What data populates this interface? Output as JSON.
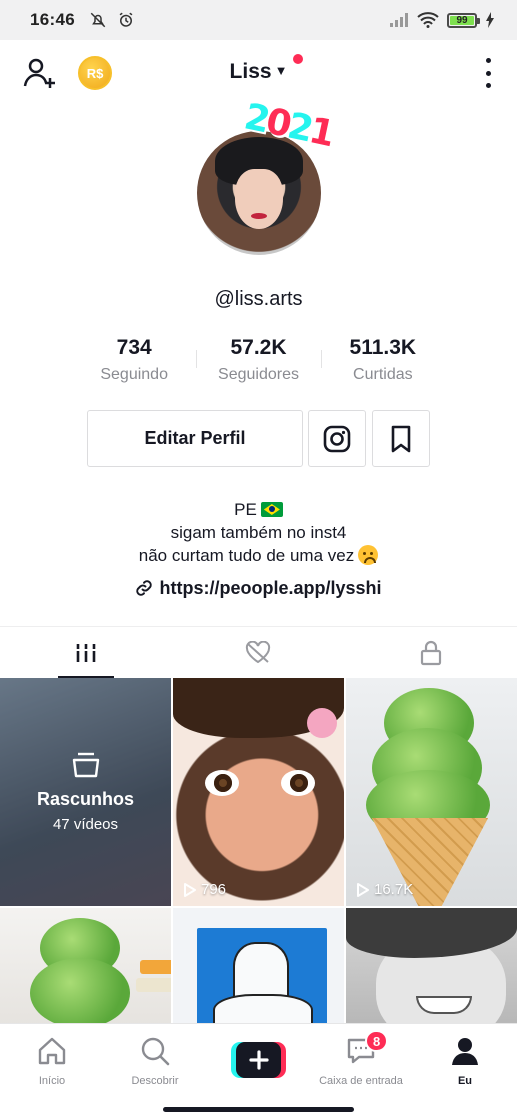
{
  "status_bar": {
    "time": "16:46",
    "battery_level": "99",
    "battery_fraction": 0.99,
    "icons": [
      "mute-bell-icon",
      "alarm-icon",
      "signal-icon",
      "wifi-icon",
      "battery-icon",
      "charging-icon"
    ]
  },
  "header": {
    "username": "Liss",
    "coin_label": "R$"
  },
  "profile": {
    "badge_year": "2021",
    "handle": "@liss.arts"
  },
  "stats": [
    {
      "value": "734",
      "label": "Seguindo"
    },
    {
      "value": "57.2K",
      "label": "Seguidores"
    },
    {
      "value": "511.3K",
      "label": "Curtidas"
    }
  ],
  "actions": {
    "edit_profile": "Editar Perfil"
  },
  "bio": {
    "line1": "PE",
    "line2": "sigam também no inst4",
    "line3": "não curtam tudo de uma vez",
    "link": "https://peoople.app/lysshi"
  },
  "tabs": [
    "videos-grid-icon",
    "liked-private-icon",
    "lock-icon"
  ],
  "grid": {
    "drafts": {
      "title": "Rascunhos",
      "count": "47 vídeos"
    },
    "videos": [
      {
        "views": "796"
      },
      {
        "views": "16.7K"
      }
    ]
  },
  "bottom_nav": {
    "home": "Início",
    "discover": "Descobrir",
    "inbox": "Caixa de entrada",
    "inbox_badge": "8",
    "me": "Eu"
  },
  "colors": {
    "accent_pink": "#fe2c55",
    "accent_cyan": "#25f4ee",
    "text": "#161823",
    "muted": "#8a8b91"
  }
}
